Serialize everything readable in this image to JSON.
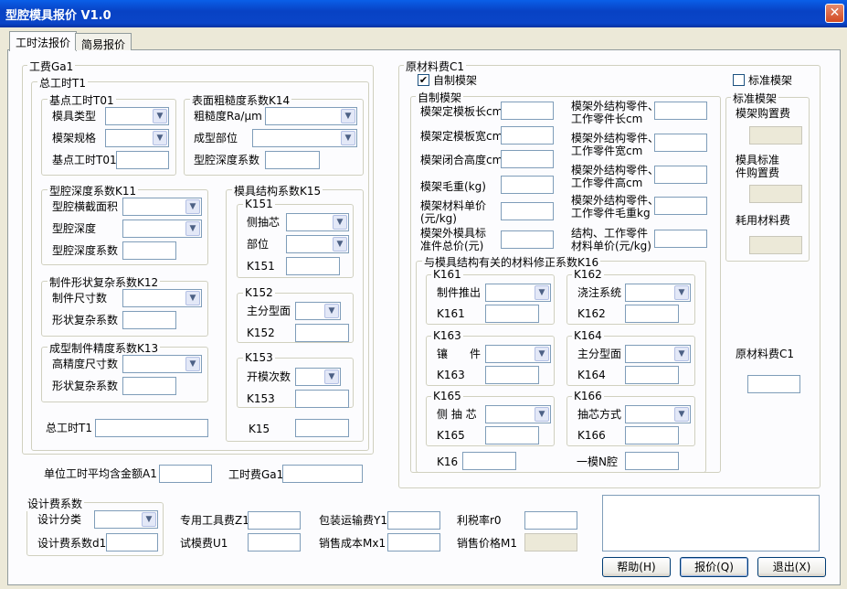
{
  "window": {
    "title": "型腔模具报价 V1.0",
    "close": "✕"
  },
  "tabs": [
    "工时法报价",
    "简易报价"
  ],
  "gong_fei": {
    "legend": "工费Ga1"
  },
  "zong_gongshi": {
    "legend": "总工时T1"
  },
  "jidian": {
    "legend": "基点工时T01",
    "mold_type": "模具类型",
    "frame_spec": "模架规格",
    "base_hours": "基点工时T01"
  },
  "roughness": {
    "legend": "表面粗糙度系数K14",
    "ra": "粗糙度Ra/μm",
    "part": "成型部位",
    "coef": "型腔深度系数"
  },
  "depth": {
    "legend": "型腔深度系数K11",
    "area": "型腔横截面积",
    "depth": "型腔深度",
    "coef": "型腔深度系数"
  },
  "shape": {
    "legend": "制件形状复杂系数K12",
    "size": "制件尺寸数",
    "complex": "形状复杂系数"
  },
  "precision": {
    "legend": "成型制件精度系数K13",
    "high": "高精度尺寸数",
    "complex": "形状复杂系数"
  },
  "structure": {
    "legend": "模具结构系数K15",
    "k151": {
      "legend": "K151",
      "side": "侧抽芯",
      "pos": "部位",
      "k": "K151"
    },
    "k152": {
      "legend": "K152",
      "parting": "主分型面",
      "k": "K152"
    },
    "k153": {
      "legend": "K153",
      "open": "开模次数",
      "k": "K153"
    },
    "k15": "K15"
  },
  "total_hours": "总工时T1",
  "unit_amount": "单位工时平均含金额A1",
  "labor_fee": "工时费Ga1",
  "raw": {
    "legend": "原材料费C1",
    "self_made": "自制模架",
    "standard": "标准模架",
    "self_group": "自制模架",
    "left": [
      "模架定模板长cm",
      "模架定模板宽cm",
      "模架闭合高度cm",
      "模架毛重(kg)",
      "模架材料单价\n(元/kg)",
      "模架外模具标\n准件总价(元)"
    ],
    "right": [
      "模架外结构零件、\n工作零件长cm",
      "模架外结构零件、\n工作零件宽cm",
      "模架外结构零件、\n工作零件高cm",
      "模架外结构零件、\n工作零件毛重kg",
      "结构、工作零件\n材料单价(元/kg)"
    ],
    "std_group": "标准模架",
    "std_price": "模架购置费",
    "std_parts": "模具标准\n件购置费",
    "consumables": "耗用材料费",
    "total": "原材料费C1"
  },
  "k16": {
    "legend": "与模具结构有关的材料修正系数K16",
    "k161": {
      "legend": "K161",
      "a": "制件推出",
      "k": "K161"
    },
    "k162": {
      "legend": "K162",
      "a": "浇注系统",
      "k": "K162"
    },
    "k163": {
      "legend": "K163",
      "a": "镶　　件",
      "k": "K163"
    },
    "k164": {
      "legend": "K164",
      "a": "主分型面",
      "k": "K164"
    },
    "k165": {
      "legend": "K165",
      "a": "侧 抽 芯",
      "k": "K165"
    },
    "k166": {
      "legend": "K166",
      "a": "抽芯方式",
      "k": "K166"
    },
    "k16": "K16",
    "cavity": "一模N腔"
  },
  "design": {
    "legend": "设计费系数",
    "cat": "设计分类",
    "coef": "设计费系数d1"
  },
  "costs": {
    "tool": "专用工具费Z1",
    "pack": "包装运输费Y1",
    "tax": "利税率r0",
    "trial": "试模费U1",
    "sales_cost": "销售成本Mx1",
    "sales_price": "销售价格M1"
  },
  "buttons": {
    "help": "帮助(H)",
    "quote": "报价(Q)",
    "exit": "退出(X)"
  },
  "icons": {
    "dropdown": "▼",
    "check": "✔"
  }
}
